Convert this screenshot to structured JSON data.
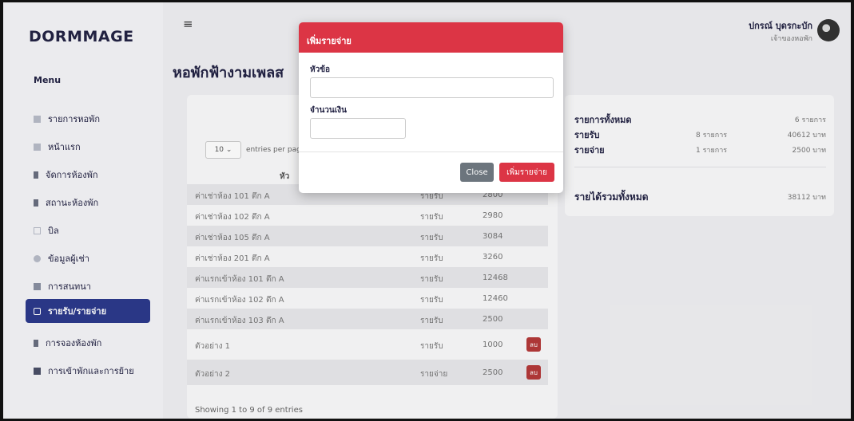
{
  "brand": "DORMMAGE",
  "sidebar": {
    "menu_heading": "Menu",
    "items": [
      {
        "label": "รายการหอพัก",
        "icon": "grid-icon"
      },
      {
        "label": "หน้าแรก",
        "icon": "dashboard-icon"
      },
      {
        "label": "จัดการห้องพัก",
        "icon": "building-icon"
      },
      {
        "label": "สถานะห้องพัก",
        "icon": "building-status-icon"
      },
      {
        "label": "บิล",
        "icon": "bill-icon"
      },
      {
        "label": "ข้อมูลผู้เช่า",
        "icon": "users-icon"
      },
      {
        "label": "การสนทนา",
        "icon": "chat-icon"
      },
      {
        "label": "รายรับ/รายจ่าย",
        "icon": "wallet-icon",
        "active": true
      },
      {
        "label": "การจองห้องพัก",
        "icon": "booking-icon"
      },
      {
        "label": "การเข้าพักและการย้าย",
        "icon": "move-icon"
      }
    ]
  },
  "header": {
    "user_name": "ปกรณ์ บุดรกะบัก",
    "user_role": "เจ้าของหอพัก",
    "page_title": "หอพักฟ้างามเพลส"
  },
  "table": {
    "length_value": "10 ⌄",
    "length_label": "entries per page",
    "header_fragment": "หัว",
    "rows": [
      {
        "title": "ค่าเช่าห้อง 101 ตึก A",
        "type": "รายรับ",
        "amount": "2800"
      },
      {
        "title": "ค่าเช่าห้อง 102 ตึก A",
        "type": "รายรับ",
        "amount": "2980"
      },
      {
        "title": "ค่าเช่าห้อง 105 ตึก A",
        "type": "รายรับ",
        "amount": "3084"
      },
      {
        "title": "ค่าเช่าห้อง 201 ตึก A",
        "type": "รายรับ",
        "amount": "3260"
      },
      {
        "title": "ค่าแรกเข้าห้อง 101 ตึก A",
        "type": "รายรับ",
        "amount": "12468"
      },
      {
        "title": "ค่าแรกเข้าห้อง 102 ตึก A",
        "type": "รายรับ",
        "amount": "12460"
      },
      {
        "title": "ค่าแรกเข้าห้อง 103 ตึก A",
        "type": "รายรับ",
        "amount": "2500"
      },
      {
        "title": "ตัวอย่าง 1",
        "type": "รายรับ",
        "amount": "1000",
        "delete_label": "ลบ"
      },
      {
        "title": "ตัวอย่าง 2",
        "type": "รายจ่าย",
        "amount": "2500",
        "delete_label": "ลบ"
      }
    ],
    "footer": "Showing 1 to 9 of 9 entries"
  },
  "summary": {
    "total_label": "รายการทั้งหมด",
    "total_value": "6 รายการ",
    "income_label": "รายรับ",
    "income_count": "8 รายการ",
    "income_value": "40612 บาท",
    "expense_label": "รายจ่าย",
    "expense_count": "1 รายการ",
    "expense_value": "2500 บาท",
    "net_label": "รายได้รวมทั้งหมด",
    "net_value": "38112 บาท"
  },
  "modal": {
    "title": "เพิ่มรายจ่าย",
    "field1_label": "หัวข้อ",
    "field1_value": "",
    "field2_label": "จำนวนเงิน",
    "field2_value": "",
    "close_label": "Close",
    "submit_label": "เพิ่มรายจ่าย"
  },
  "colors": {
    "accent": "#dc3545",
    "nav_active": "#2c3a8c",
    "brand": "#232344"
  }
}
